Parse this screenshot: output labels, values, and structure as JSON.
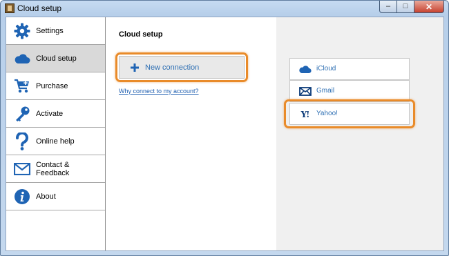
{
  "window": {
    "title": "Cloud setup",
    "minimize_glyph": "–",
    "maximize_glyph": "□",
    "close_glyph": "✕"
  },
  "sidebar": {
    "items": [
      {
        "label": "Settings",
        "icon": "gear-icon",
        "active": false
      },
      {
        "label": "Cloud setup",
        "icon": "cloud-icon",
        "active": true
      },
      {
        "label": "Purchase",
        "icon": "cart-icon",
        "active": false
      },
      {
        "label": "Activate",
        "icon": "key-icon",
        "active": false
      },
      {
        "label": "Online help",
        "icon": "question-icon",
        "active": false
      },
      {
        "label": "Contact &\nFeedback",
        "icon": "envelope-icon",
        "active": false
      },
      {
        "label": "About",
        "icon": "info-icon",
        "active": false
      }
    ]
  },
  "main": {
    "title": "Cloud setup",
    "new_connection_label": "New connection",
    "why_link": "Why connect to my account?"
  },
  "providers": [
    {
      "label": "iCloud",
      "icon": "cloud-icon"
    },
    {
      "label": "Gmail",
      "icon": "envelope-icon"
    },
    {
      "label": "Yahoo!",
      "icon": "yahoo-icon",
      "icon_text": "Y!"
    }
  ],
  "colors": {
    "accent": "#1f64b4",
    "highlight": "#e98b2a",
    "link": "#2e6fb3",
    "active_nav": "#d9d9d9"
  }
}
